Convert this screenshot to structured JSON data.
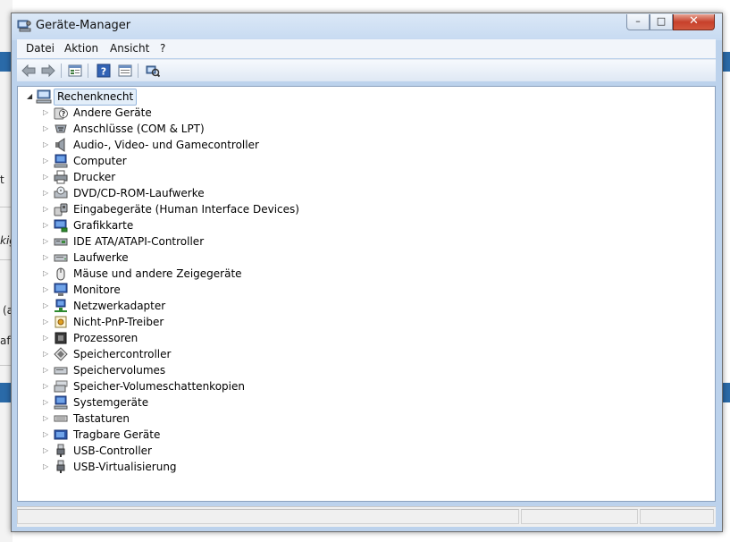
{
  "window": {
    "title": "Geräte-Manager",
    "caption_buttons": {
      "minimize": "–",
      "maximize": "□",
      "close": "✕"
    }
  },
  "menu": [
    "Datei",
    "Aktion",
    "Ansicht",
    "?"
  ],
  "toolbar": [
    "back-arrow-icon",
    "forward-arrow-icon",
    "properties-icon",
    "help-icon",
    "details-view-icon",
    "scan-hardware-icon"
  ],
  "background": {
    "fragments": [
      "t",
      "kig",
      "(a",
      "af"
    ]
  },
  "tree": {
    "root": "Rechenknecht",
    "items": [
      {
        "label": "Andere Geräte",
        "icon": "unknown-device-icon"
      },
      {
        "label": "Anschlüsse (COM & LPT)",
        "icon": "port-icon"
      },
      {
        "label": "Audio-, Video- und Gamecontroller",
        "icon": "speaker-icon"
      },
      {
        "label": "Computer",
        "icon": "computer-icon"
      },
      {
        "label": "Drucker",
        "icon": "printer-icon"
      },
      {
        "label": "DVD/CD-ROM-Laufwerke",
        "icon": "disc-drive-icon"
      },
      {
        "label": "Eingabegeräte (Human Interface Devices)",
        "icon": "hid-icon"
      },
      {
        "label": "Grafikkarte",
        "icon": "display-adapter-icon"
      },
      {
        "label": "IDE ATA/ATAPI-Controller",
        "icon": "ide-controller-icon"
      },
      {
        "label": "Laufwerke",
        "icon": "disk-drive-icon"
      },
      {
        "label": "Mäuse und andere Zeigegeräte",
        "icon": "mouse-icon"
      },
      {
        "label": "Monitore",
        "icon": "monitor-icon"
      },
      {
        "label": "Netzwerkadapter",
        "icon": "network-adapter-icon"
      },
      {
        "label": "Nicht-PnP-Treiber",
        "icon": "non-pnp-driver-icon"
      },
      {
        "label": "Prozessoren",
        "icon": "processor-icon"
      },
      {
        "label": "Speichercontroller",
        "icon": "storage-controller-icon"
      },
      {
        "label": "Speichervolumes",
        "icon": "storage-volume-icon"
      },
      {
        "label": "Speicher-Volumeschattenkopien",
        "icon": "shadow-copy-icon"
      },
      {
        "label": "Systemgeräte",
        "icon": "system-device-icon"
      },
      {
        "label": "Tastaturen",
        "icon": "keyboard-icon"
      },
      {
        "label": "Tragbare Geräte",
        "icon": "portable-device-icon"
      },
      {
        "label": "USB-Controller",
        "icon": "usb-icon"
      },
      {
        "label": "USB-Virtualisierung",
        "icon": "usb-icon"
      }
    ]
  },
  "status": {
    "cells": [
      "",
      "",
      ""
    ]
  }
}
